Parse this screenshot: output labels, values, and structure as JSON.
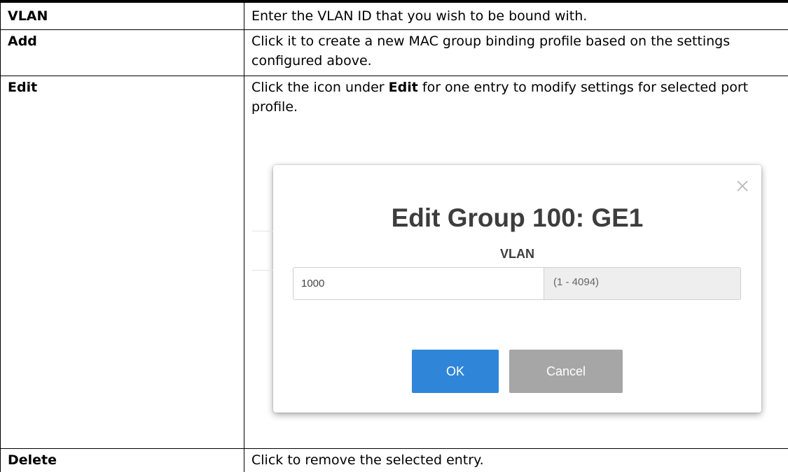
{
  "rows": [
    {
      "term": "VLAN",
      "description": "Enter the VLAN ID that you wish to be bound with."
    },
    {
      "term": "Add",
      "description": "Click it to create a new MAC group binding profile based on the settings configured above."
    },
    {
      "term": "Edit",
      "description_before": "Click the icon under ",
      "description_bold": "Edit",
      "description_after": " for one entry to modify settings for selected port profile."
    },
    {
      "term": "Delete",
      "description": "Click to remove the selected entry."
    }
  ],
  "dialog": {
    "title": "Edit Group 100: GE1",
    "field_label": "VLAN",
    "vlan_value": "1000",
    "range_hint": "(1 - 4094)",
    "ok_label": "OK",
    "cancel_label": "Cancel",
    "colors": {
      "ok_button": "#2f86d8",
      "cancel_button": "#a6a6a6",
      "title_text": "#3d3d3d"
    },
    "close_icon": "close-icon"
  }
}
